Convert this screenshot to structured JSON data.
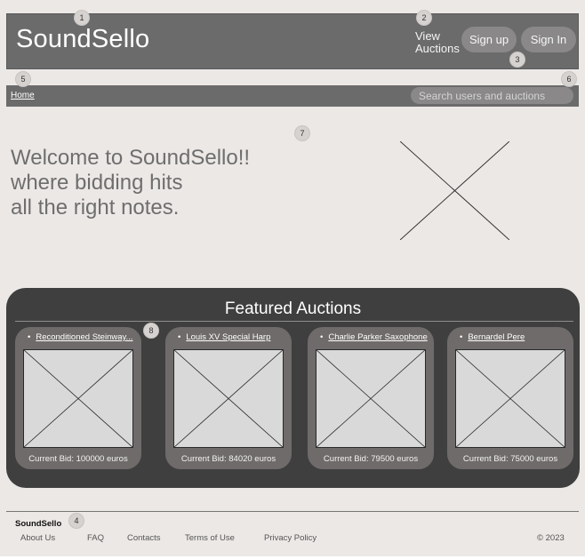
{
  "header": {
    "logo": "SoundSello",
    "nav_view_auctions": "View Auctions",
    "signup_label": "Sign up",
    "signin_label": "Sign In"
  },
  "subbar": {
    "home_label": "Home",
    "search_placeholder": "Search users and auctions"
  },
  "hero": {
    "welcome_text": "Welcome to SoundSello!!\nwhere bidding hits\nall the right notes."
  },
  "featured": {
    "title": "Featured Auctions",
    "cards": [
      {
        "title": "Reconditioned Steinway...",
        "bid": "Current Bid: 100000 euros"
      },
      {
        "title": "Louis XV Special Harp",
        "bid": "Current Bid: 84020 euros"
      },
      {
        "title": "Charlie Parker Saxophone",
        "bid": "Current Bid: 79500 euros"
      },
      {
        "title": "Bernardel Pere",
        "bid": "Current Bid: 75000 euros"
      }
    ]
  },
  "footer": {
    "brand": "SoundSello",
    "links": [
      "About Us",
      "FAQ",
      "Contacts",
      "Terms of Use",
      "Privacy Policy"
    ],
    "copyright": "© 2023"
  },
  "markers": [
    "1",
    "2",
    "3",
    "4",
    "5",
    "6",
    "7",
    "8"
  ],
  "colors": {
    "background": "#ece8e6",
    "header": "#6b6b6b",
    "featured_panel": "#3f3f3f",
    "card": "#6f6b6a",
    "pill": "#8a8888"
  }
}
